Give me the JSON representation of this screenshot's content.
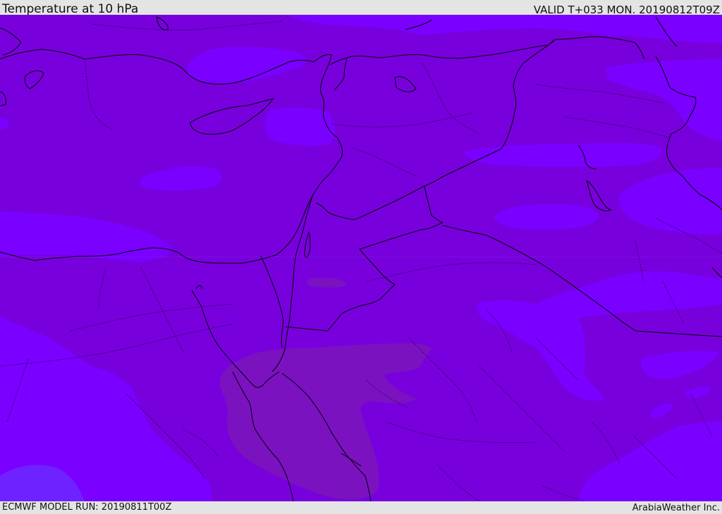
{
  "header": {
    "title": "Temperature at 10 hPa",
    "valid": "VALID T+033 MON. 20190812T09Z"
  },
  "footer": {
    "model_run": "ECMWF MODEL RUN: 20190811T00Z",
    "credit": "ArabiaWeather Inc."
  },
  "colors": {
    "base_field": "#7800dd",
    "cooler_field": "#7a00ff",
    "coldest_field": "#6e22ff",
    "warmer_field": "#7b12c0",
    "coastline": "#000000",
    "border": "#000000"
  }
}
